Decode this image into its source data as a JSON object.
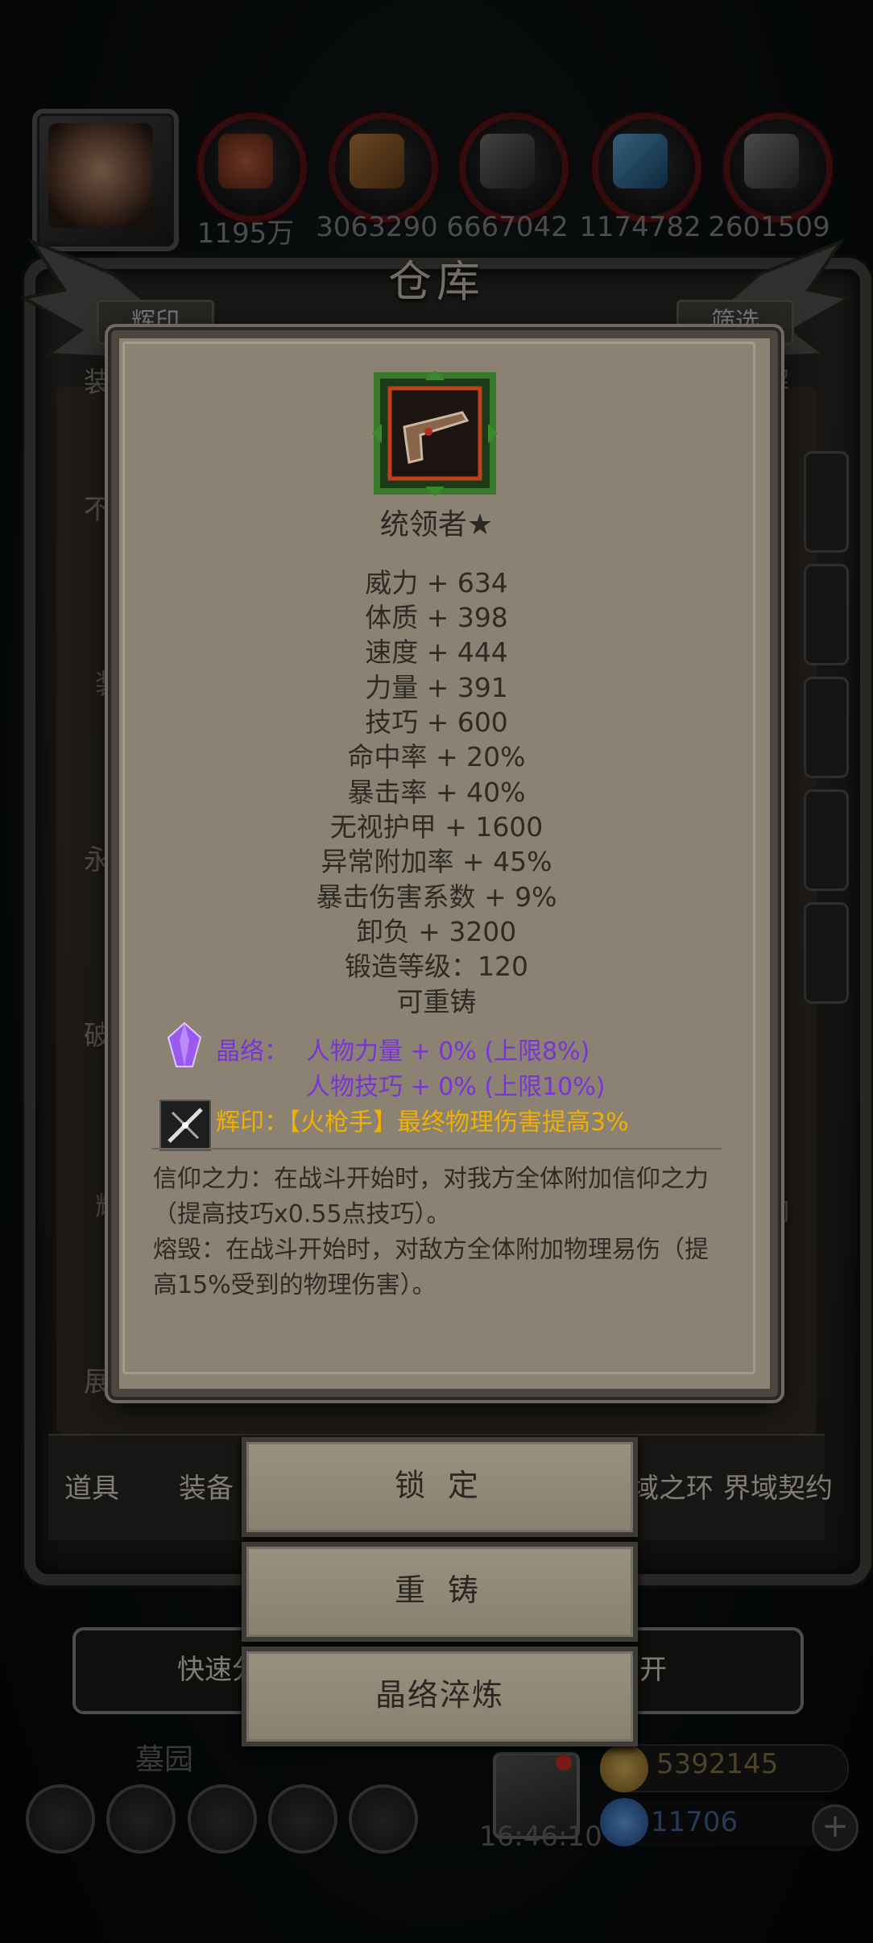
{
  "resources": [
    {
      "icon": "meat-icon",
      "value": "1195万"
    },
    {
      "icon": "wood-icon",
      "value": "3063290"
    },
    {
      "icon": "stone-icon",
      "value": "6667042"
    },
    {
      "icon": "crystal-icon",
      "value": "1174782"
    },
    {
      "icon": "iron-icon",
      "value": "2601509"
    }
  ],
  "warehouse": {
    "title": "仓库",
    "top_left_button": "辉印",
    "top_right_button": "筛选",
    "background_left_labels": [
      "装",
      "不",
      "装",
      "永",
      "破",
      "辉",
      "展"
    ],
    "background_right_labels": [
      "解",
      "响"
    ],
    "tabs": [
      "道具",
      "装备",
      "界域之环",
      "界域契约"
    ],
    "bottom_left_button": "快速分",
    "bottom_right_button": "离开"
  },
  "hud": {
    "area_name": "墓园",
    "clock": "16:46:10",
    "gold": "5392145",
    "gems": "11706",
    "plus_label": "+"
  },
  "item": {
    "icon": "flintlock-pistol-icon",
    "name": "统领者★",
    "stats": [
      "威力 + 634",
      "体质 + 398",
      "速度 + 444",
      "力量 + 391",
      "技巧 + 600",
      "命中率 + 20%",
      "暴击率 + 40%",
      "无视护甲 + 1600",
      "异常附加率 + 45%",
      "暴击伤害系数 + 9%",
      "卸负 + 3200",
      "锻造等级：120",
      "可重铸"
    ],
    "crystal_label": "晶络：",
    "crystal_lines": [
      "人物力量 + 0%  (上限8%)",
      "人物技巧 + 0%  (上限10%)"
    ],
    "emblem_text": "辉印：【火枪手】最终物理伤害提高3%",
    "description": "信仰之力：在战斗开始时，对我方全体附加信仰之力（提高技巧x0.55点技巧）。\n熔毁：在战斗开始时，对敌方全体附加物理易伤（提高15%受到的物理伤害）。"
  },
  "actions": {
    "lock": "锁 定",
    "reforge": "重 铸",
    "crystal_refine": "晶络淬炼"
  },
  "colors": {
    "popup_bg": "#8b8274",
    "crystal_purple": "#7a34d4",
    "emblem_gold": "#f0b000",
    "resource_ring": "#5e1818"
  }
}
